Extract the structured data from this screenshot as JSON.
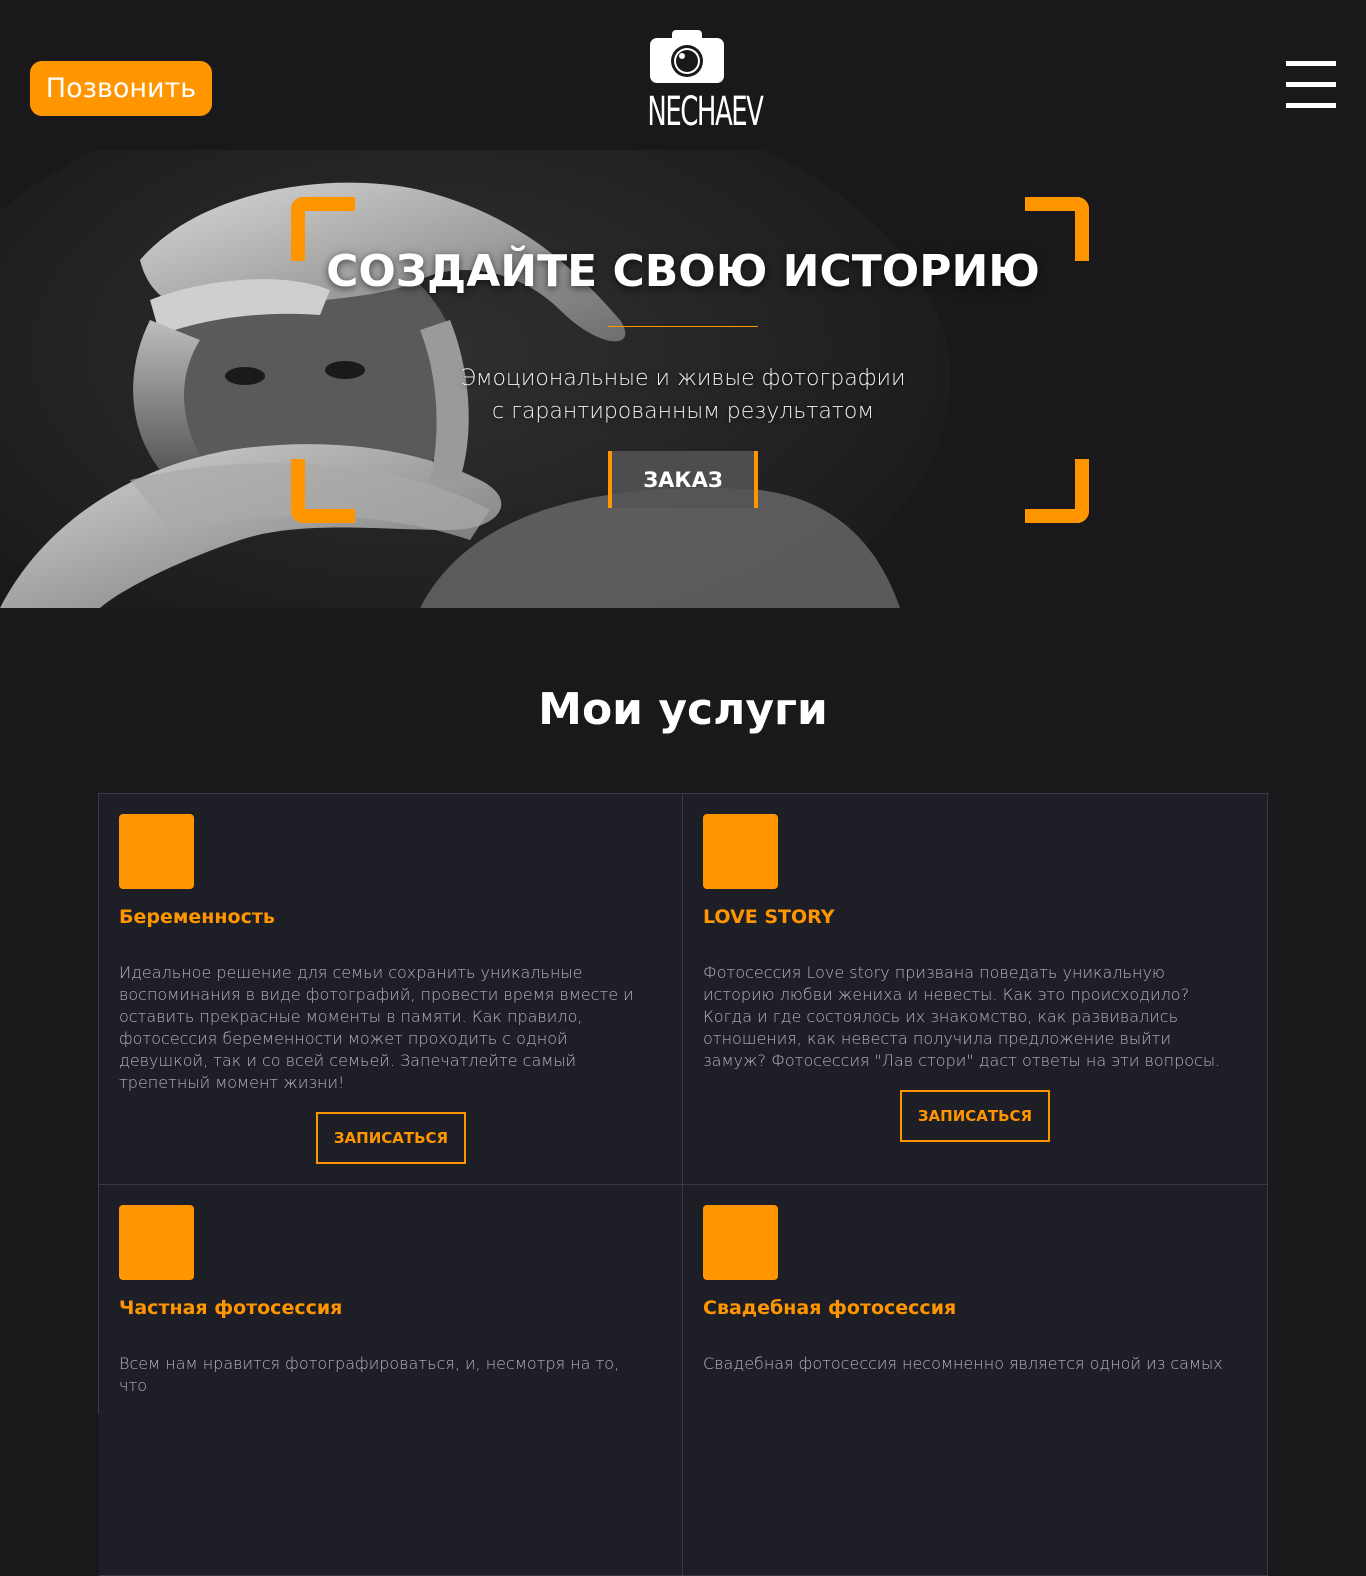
{
  "header": {
    "call_label": "Позвонить",
    "logo_text": "NECHAEV"
  },
  "hero": {
    "title": "СОЗДАЙТЕ СВОЮ ИСТОРИЮ",
    "subtitle_line1": "Эмоциональные и живые фотографии",
    "subtitle_line2": "с гарантированным результатом",
    "order_label": "ЗАКАЗ"
  },
  "services": {
    "title": "Мои услуги",
    "items": [
      {
        "title": "Беременность",
        "text": "Идеальное решение для семьи сохранить уникальные воспоминания в виде фотографий, провести время вместе и оставить прекрасные моменты в памяти. Как правило, фотосессия беременности может проходить с одной девушкой, так и со всей семьей. Запечатлейте самый трепетный момент жизни!",
        "button": "ЗАПИСАТЬСЯ"
      },
      {
        "title": "LOVE STORY",
        "text": "Фотосессия Love story призвана поведать уникальную историю любви жениха и невесты. Как это происходило? Когда и где состоялось их знакомство, как развивались отношения, как невеста получила предложение выйти замуж? Фотосессия \"Лав стори\" даст ответы на эти вопросы.",
        "button": "ЗАПИСАТЬСЯ"
      },
      {
        "title": "Частная фотосессия",
        "text": "Всем нам нравится фотографироваться, и, несмотря на то, что",
        "button": ""
      },
      {
        "title": "Свадебная фотосессия",
        "text": "Свадебная фотосессия несомненно является одной из самых",
        "button": ""
      }
    ]
  },
  "colors": {
    "accent": "#ff9600",
    "background": "#19191b",
    "card": "#1e1e26"
  }
}
